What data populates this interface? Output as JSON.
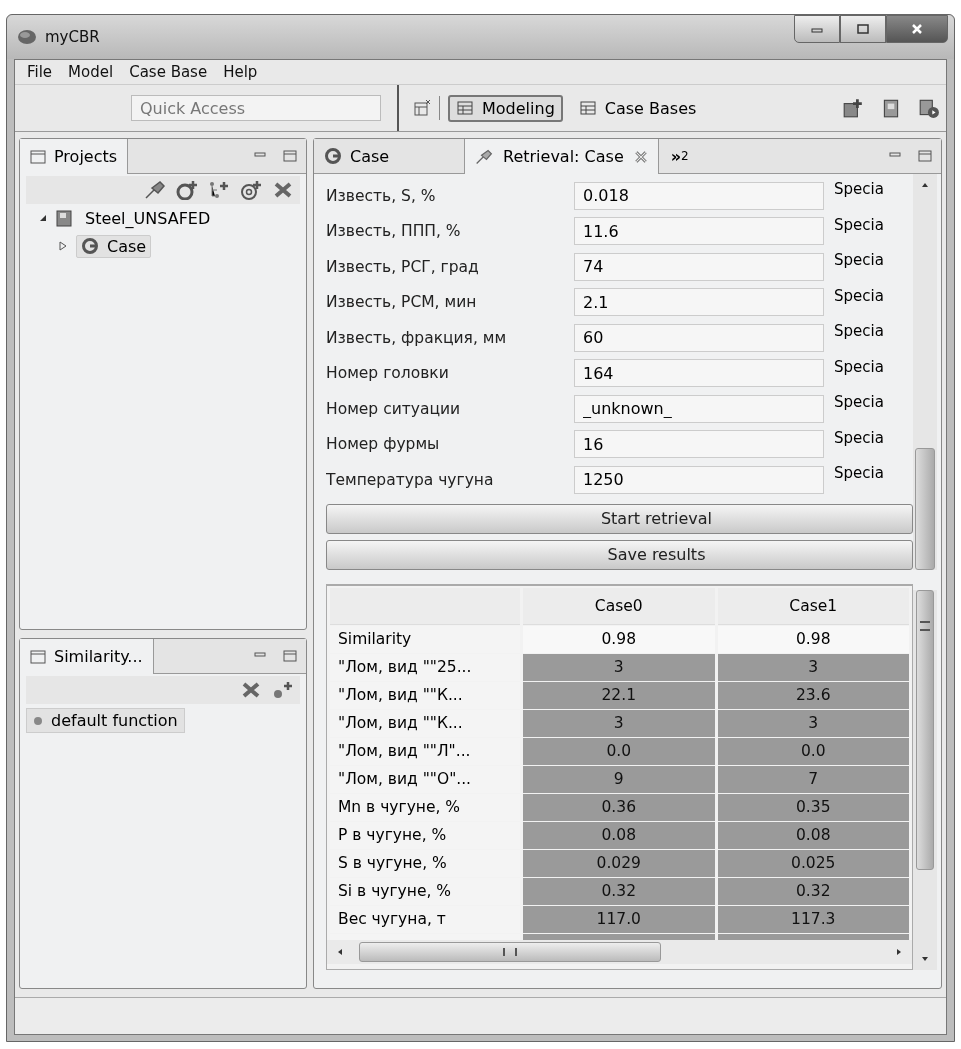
{
  "window": {
    "title": "myCBR"
  },
  "menu": [
    "File",
    "Model",
    "Case Base",
    "Help"
  ],
  "toolbar": {
    "quick_access": {
      "placeholder": "Quick Access"
    },
    "perspectives": [
      {
        "label": "Modeling",
        "selected": true
      },
      {
        "label": "Case Bases",
        "selected": false
      }
    ]
  },
  "projects_panel": {
    "title": "Projects",
    "tree": [
      {
        "label": "Steel_UNSAFED",
        "expanded": true,
        "selected": false,
        "children": [
          {
            "label": "Case",
            "expanded": false,
            "selected": true
          }
        ]
      }
    ]
  },
  "similarity_panel": {
    "title": "Similarity...",
    "items": [
      {
        "label": "default function",
        "selected": true
      }
    ]
  },
  "editor": {
    "tabs": [
      {
        "label": "Case",
        "selected": false,
        "closable": false
      },
      {
        "label": "Retrieval: Case",
        "selected": true,
        "closable": true
      }
    ],
    "overflow": "»",
    "overflow_count": "2",
    "fields": [
      {
        "label": "Известь, S, %",
        "value": "0.018",
        "option": "Specia"
      },
      {
        "label": "Известь, ППП, %",
        "value": "11.6",
        "option": "Specia"
      },
      {
        "label": "Известь, РСГ, град",
        "value": "74",
        "option": "Specia"
      },
      {
        "label": "Известь, РСМ, мин",
        "value": "2.1",
        "option": "Specia"
      },
      {
        "label": "Известь, фракция, мм",
        "value": "60",
        "option": "Specia"
      },
      {
        "label": "Номер головки",
        "value": "164",
        "option": "Specia"
      },
      {
        "label": "Номер ситуации",
        "value": "_unknown_",
        "option": "Specia"
      },
      {
        "label": "Номер фурмы",
        "value": "16",
        "option": "Specia"
      },
      {
        "label": "Температура чугуна",
        "value": "1250",
        "option": "Specia"
      }
    ],
    "buttons": [
      "Start retrieval",
      "Save results"
    ],
    "results": {
      "columns": [
        "Case0",
        "Case1"
      ],
      "rows": [
        {
          "label": "Similarity",
          "shaded": false,
          "values": [
            "0.98",
            "0.98"
          ]
        },
        {
          "label": "\"Лом, вид \"\"25...",
          "shaded": true,
          "values": [
            "3",
            "3"
          ]
        },
        {
          "label": "\"Лом, вид \"\"К...",
          "shaded": true,
          "values": [
            "22.1",
            "23.6"
          ]
        },
        {
          "label": "\"Лом, вид \"\"К...",
          "shaded": true,
          "values": [
            "3",
            "3"
          ]
        },
        {
          "label": "\"Лом, вид \"\"Л\"...",
          "shaded": true,
          "values": [
            "0.0",
            "0.0"
          ]
        },
        {
          "label": "\"Лом, вид \"\"О\"...",
          "shaded": true,
          "values": [
            "9",
            "7"
          ]
        },
        {
          "label": "Mn в чугуне, %",
          "shaded": true,
          "values": [
            "0.36",
            "0.35"
          ]
        },
        {
          "label": "P в чугуне, %",
          "shaded": true,
          "values": [
            "0.08",
            "0.08"
          ]
        },
        {
          "label": "S в чугуне, %",
          "shaded": true,
          "values": [
            "0.029",
            "0.025"
          ]
        },
        {
          "label": "Si в чугуне, %",
          "shaded": true,
          "values": [
            "0.32",
            "0.32"
          ]
        },
        {
          "label": "Вес чугуна, т",
          "shaded": true,
          "values": [
            "117.0",
            "117.3"
          ]
        }
      ]
    }
  }
}
